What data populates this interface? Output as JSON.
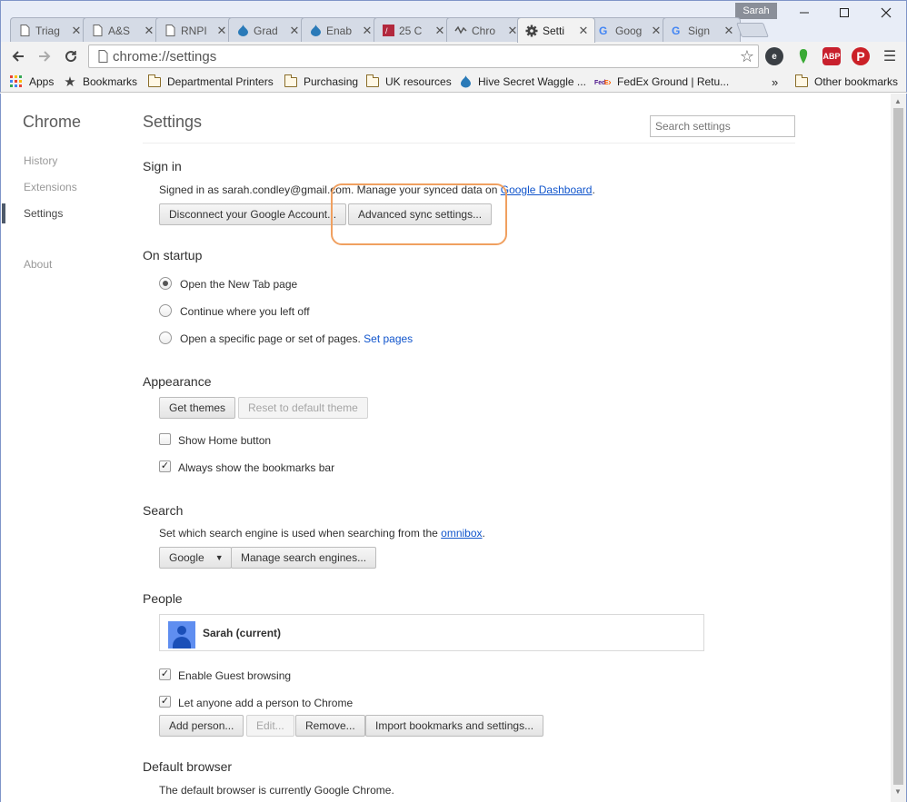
{
  "window": {
    "profile_name": "Sarah",
    "minimize": "—",
    "maximize": "☐",
    "close": "✕"
  },
  "tabs": [
    {
      "label": "Triag",
      "icon": "page-icon"
    },
    {
      "label": "A&S",
      "icon": "page-icon"
    },
    {
      "label": "RNPI",
      "icon": "page-icon"
    },
    {
      "label": "Grad",
      "icon": "drupal-icon"
    },
    {
      "label": "Enab",
      "icon": "drupal-icon"
    },
    {
      "label": "25 C",
      "icon": "red-icon"
    },
    {
      "label": "Chro",
      "icon": "wave-icon"
    },
    {
      "label": "Setti",
      "icon": "gear-icon",
      "active": true
    },
    {
      "label": "Goog",
      "icon": "google-icon"
    },
    {
      "label": "Sign",
      "icon": "google-icon"
    }
  ],
  "toolbar": {
    "url": "chrome://settings"
  },
  "bookmarks": {
    "items": [
      {
        "label": "Apps",
        "icon": "apps-icon"
      },
      {
        "label": "Bookmarks",
        "icon": "star-icon"
      },
      {
        "label": "Departmental Printers",
        "icon": "folder-icon"
      },
      {
        "label": "Purchasing",
        "icon": "folder-icon"
      },
      {
        "label": "UK resources",
        "icon": "folder-icon"
      },
      {
        "label": "Hive Secret Waggle ...",
        "icon": "drupal-icon"
      },
      {
        "label": "FedEx Ground | Retu...",
        "icon": "fedex-icon"
      }
    ],
    "overflow": "»",
    "other": "Other bookmarks"
  },
  "sidebar": {
    "title": "Chrome",
    "items": [
      "History",
      "Extensions",
      "Settings",
      "About"
    ],
    "active": "Settings"
  },
  "settings": {
    "title": "Settings",
    "search_placeholder": "Search settings",
    "signin": {
      "heading": "Sign in",
      "text_prefix": "Signed in as sarah.condley@gmail.com. Manage your synced data on ",
      "dashboard_link": "Google Dashboard",
      "text_suffix": ".",
      "disconnect": "Disconnect your Google Account...",
      "advanced_sync": "Advanced sync settings..."
    },
    "startup": {
      "heading": "On startup",
      "options": [
        "Open the New Tab page",
        "Continue where you left off",
        "Open a specific page or set of pages."
      ],
      "selected": 0,
      "set_pages": "Set pages"
    },
    "appearance": {
      "heading": "Appearance",
      "get_themes": "Get themes",
      "reset_theme": "Reset to default theme",
      "show_home": "Show Home button",
      "show_home_checked": false,
      "bookmarks_bar": "Always show the bookmarks bar",
      "bookmarks_bar_checked": true
    },
    "search": {
      "heading": "Search",
      "text_prefix": "Set which search engine is used when searching from the ",
      "omnibox_link": "omnibox",
      "text_suffix": ".",
      "engine": "Google",
      "manage": "Manage search engines..."
    },
    "people": {
      "heading": "People",
      "current_user": "Sarah (current)",
      "guest": "Enable Guest browsing",
      "guest_checked": true,
      "anyone_add": "Let anyone add a person to Chrome",
      "anyone_add_checked": true,
      "add_person": "Add person...",
      "edit": "Edit...",
      "remove": "Remove...",
      "import": "Import bookmarks and settings..."
    },
    "default_browser": {
      "heading": "Default browser",
      "text": "The default browser is currently Google Chrome."
    }
  },
  "colors": {
    "link": "#1155cc",
    "highlight": "#f0a060"
  }
}
